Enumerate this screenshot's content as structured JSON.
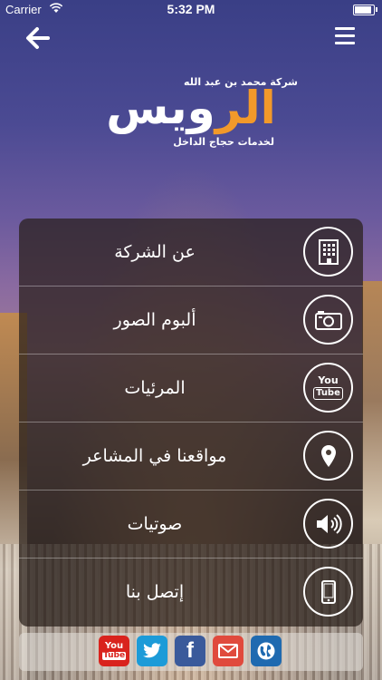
{
  "status": {
    "carrier": "Carrier",
    "time": "5:32 PM",
    "battery_level": 0.95
  },
  "logo": {
    "top_text": "شركة محمد بن عبد الله",
    "main_text_a": "الر",
    "main_text_b": "ويس",
    "sub_text": "لخدمات حجاج الداخل"
  },
  "menu": {
    "items": [
      {
        "label": "عن الشركة",
        "icon": "building-icon"
      },
      {
        "label": "ألبوم الصور",
        "icon": "camera-icon"
      },
      {
        "label": "المرئيات",
        "icon": "youtube-icon"
      },
      {
        "label": "مواقعنا في المشاعر",
        "icon": "location-pin-icon"
      },
      {
        "label": "صوتيات",
        "icon": "speaker-icon"
      },
      {
        "label": "إتصل بنا",
        "icon": "phone-icon"
      }
    ]
  },
  "social": [
    {
      "name": "youtube",
      "color": "#d9231d"
    },
    {
      "name": "twitter",
      "color": "#1c9bd8"
    },
    {
      "name": "facebook",
      "color": "#3a5a9b"
    },
    {
      "name": "email",
      "color": "#e04a3d"
    },
    {
      "name": "website",
      "color": "#1f6ab0"
    }
  ],
  "icons": {
    "youtube_text_top": "You",
    "youtube_text_bottom": "Tube",
    "facebook_letter": "f"
  }
}
